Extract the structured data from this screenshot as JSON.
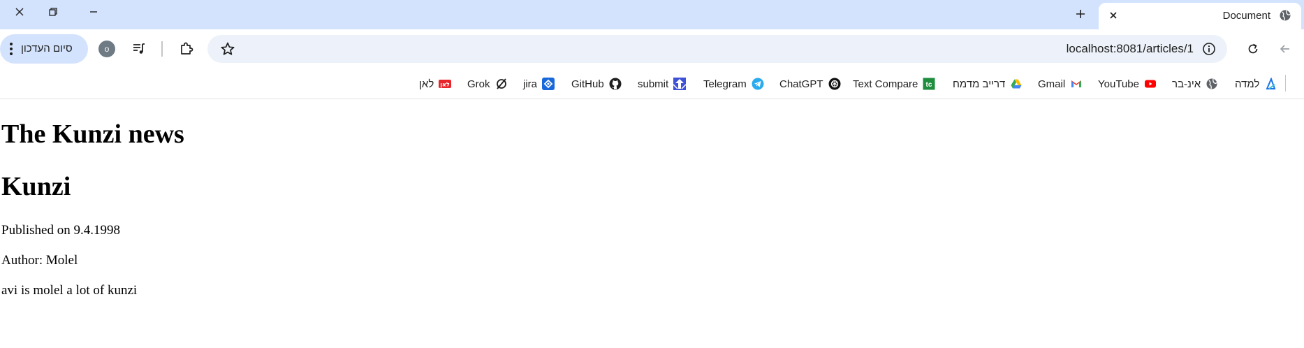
{
  "window": {
    "tab_title": "Document"
  },
  "toolbar": {
    "url": "localhost:8081/articles/1",
    "profile_initial": "o",
    "update_label": "סיום העדכון"
  },
  "bookmarks": [
    {
      "label": "למדה",
      "icon": "lamda-icon"
    },
    {
      "label": "אינ-בר",
      "icon": "globe-icon"
    },
    {
      "label": "YouTube",
      "icon": "youtube-icon"
    },
    {
      "label": "Gmail",
      "icon": "gmail-icon"
    },
    {
      "label": "דרייב מדמח",
      "icon": "drive-icon"
    },
    {
      "label": "Text Compare",
      "icon": "textcompare-icon"
    },
    {
      "label": "ChatGPT",
      "icon": "chatgpt-icon"
    },
    {
      "label": "Telegram",
      "icon": "telegram-icon"
    },
    {
      "label": "submit",
      "icon": "submit-icon"
    },
    {
      "label": "GitHub",
      "icon": "github-icon"
    },
    {
      "label": "jira",
      "icon": "jira-icon"
    },
    {
      "label": "Grok",
      "icon": "grok-icon"
    },
    {
      "label": "לאן",
      "icon": "lan-icon"
    }
  ],
  "page": {
    "site_title": "The Kunzi news",
    "article_title": "Kunzi",
    "published": "Published on 9.4.1998",
    "author": "Author: Molel",
    "body": "avi is molel a lot of kunzi"
  },
  "colors": {
    "tabstrip_bg": "#d3e3fd",
    "omnibox_bg": "#edf2fa",
    "update_btn_bg": "#d3e3fd"
  }
}
